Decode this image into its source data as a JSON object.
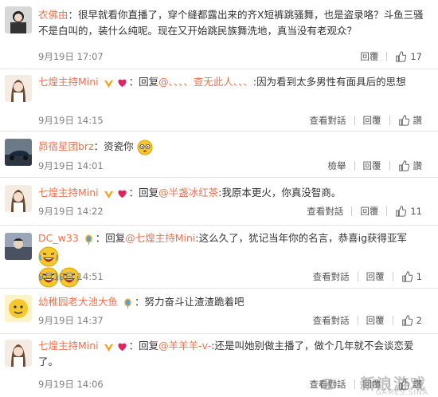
{
  "comments": [
    {
      "user": "衣佛由",
      "sep": "：",
      "text": "很早就看你直播了，穿个缝都露出来的齐X短裤跳骚舞，也是盗录咯？斗鱼三骚不是白叫的，装什么纯呢。现在又开始跳民族舞洗地，真当没有老观众？",
      "date": "9月19日 17:07",
      "reply_label": "回覆",
      "likes": "17"
    },
    {
      "user": "七煌主持Mini",
      "reply_prefix": "：回复",
      "mention": "@、、、、查无此人、、、",
      "text": ":因为看到太多男性有面具后的思想",
      "date": "9月19日 14:15",
      "view_label": "查看對話",
      "reply_label": "回覆",
      "likes": "讚"
    },
    {
      "user": "昴宿星团brz",
      "sep": "：",
      "text": "资瓷你",
      "date": "9月19日 14:01",
      "report_label": "檢舉",
      "reply_label": "回覆",
      "likes": "讚"
    },
    {
      "user": "七煌主持Mini",
      "reply_prefix": "：回复",
      "mention": "@半盏冰红茶",
      "text": ":我原本更火，你真没智商。",
      "date": "9月19日 14:22",
      "view_label": "查看對話",
      "reply_label": "回覆",
      "likes": "11"
    },
    {
      "user": "DC_w33",
      "reply_prefix": "：回复",
      "mention": "@七煌主持Mini",
      "text": ":这么久了，犹记当年你的名言，恭喜ig获得亚军",
      "date": "9月19日 14:51",
      "view_label": "查看對話",
      "reply_label": "回覆",
      "likes": "1"
    },
    {
      "user": "幼稚园老大池大鱼",
      "sep": "：",
      "text": "努力奋斗让渣渣跪着吧",
      "date": "9月19日 14:37",
      "view_label": "查看對話",
      "reply_label": "回覆",
      "likes": "2"
    },
    {
      "user": "七煌主持Mini",
      "reply_prefix": "：回复",
      "mention": "@羊羊羊-v-",
      "text": ":还是叫她别做主播了，做个几年就不会谈恋爱了。",
      "date": "9月19日 14:06",
      "view_label": "查看對話",
      "reply_label": "回覆",
      "likes": "讚"
    }
  ],
  "watermark": {
    "text": "新浪游戏",
    "sub": "GAMES.SINA"
  },
  "colors": {
    "username": "#eb7350",
    "meta": "#808080"
  }
}
